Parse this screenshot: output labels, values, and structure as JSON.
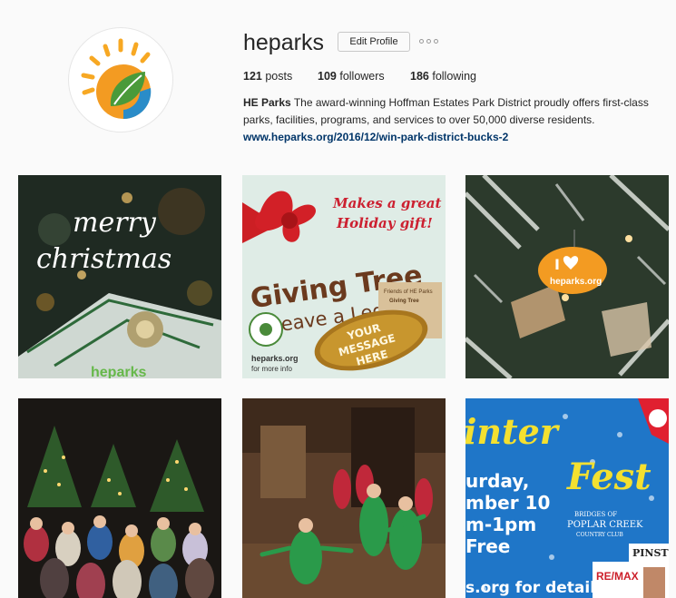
{
  "profile": {
    "username": "heparks",
    "edit_label": "Edit Profile",
    "stats": {
      "posts_count": "121",
      "posts_label": "posts",
      "followers_count": "109",
      "followers_label": "followers",
      "following_count": "186",
      "following_label": "following"
    },
    "bio_name": "HE Parks",
    "bio_text": "The award-winning Hoffman Estates Park District proudly offers first-class parks, facilities, programs, and services to over 50,000 diverse residents.",
    "bio_link": "www.heparks.org/2016/12/win-park-district-bucks-2",
    "colors": {
      "sun": "#f7a823",
      "leaf": "#4a9a3a",
      "water": "#2a8cc8",
      "link": "#003569"
    }
  },
  "posts": [
    {
      "id": "merry-christmas",
      "lines": [
        "merry",
        "christmas"
      ],
      "brand": "heparks"
    },
    {
      "id": "giving-tree",
      "tagline_1": "Makes a great",
      "tagline_2": "Holiday gift!",
      "title": "Giving Tree",
      "subtitle": "Leave a Legacy",
      "tag_1": "YOUR",
      "tag_2": "MESSAGE",
      "tag_3": "HERE",
      "site": "heparks.org",
      "site_note": "for more info",
      "plaque_1": "Friends of HE Parks",
      "plaque_2": "Giving Tree"
    },
    {
      "id": "ornament",
      "ornament_brand": "heparks.org",
      "ornament_letter": "I"
    },
    {
      "id": "kids-trees"
    },
    {
      "id": "dancers"
    },
    {
      "id": "winter-fest",
      "title_1": "inter",
      "title_2": "Fest",
      "line_1": "urday,",
      "line_2": "mber 10",
      "line_3": "m-1pm",
      "line_4": "Free",
      "footer": "s.org for details",
      "sponsor_1": "BRIDGES OF",
      "sponsor_2": "POPLAR CREEK",
      "sponsor_3": "COUNTRY CLUB",
      "sponsor_4": "PINST",
      "sponsor_5": "RE/MAX"
    }
  ]
}
